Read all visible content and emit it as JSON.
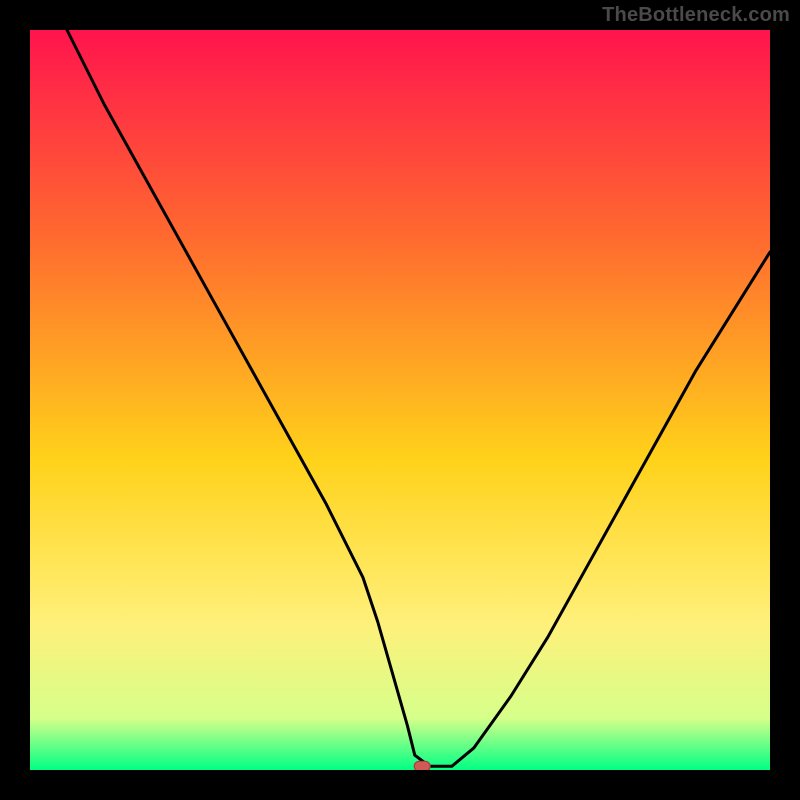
{
  "watermark": "TheBottleneck.com",
  "colors": {
    "frame": "#000000",
    "curve": "#000000",
    "marker_fill": "#d05a55",
    "marker_stroke": "#a83f3a",
    "gradient_top": "#ff144d",
    "gradient_mid1": "#ff6a2f",
    "gradient_mid2": "#ffd21a",
    "gradient_mid3": "#fff07a",
    "gradient_mid4": "#d6ff8a",
    "gradient_bottom": "#00ff84"
  },
  "chart_data": {
    "type": "line",
    "title": "",
    "xlabel": "",
    "ylabel": "",
    "xlim": [
      0,
      100
    ],
    "ylim": [
      0,
      100
    ],
    "series": [
      {
        "name": "bottleneck-curve",
        "x": [
          5,
          10,
          15,
          20,
          25,
          30,
          35,
          40,
          45,
          47,
          49,
          51,
          52,
          54,
          57,
          60,
          65,
          70,
          75,
          80,
          85,
          90,
          95,
          100
        ],
        "y": [
          100,
          90,
          81,
          72,
          63,
          54,
          45,
          36,
          26,
          20,
          13,
          6,
          2,
          0.5,
          0.5,
          3,
          10,
          18,
          27,
          36,
          45,
          54,
          62,
          70
        ]
      }
    ],
    "marker": {
      "x": 53,
      "y": 0.5
    },
    "annotations": []
  }
}
